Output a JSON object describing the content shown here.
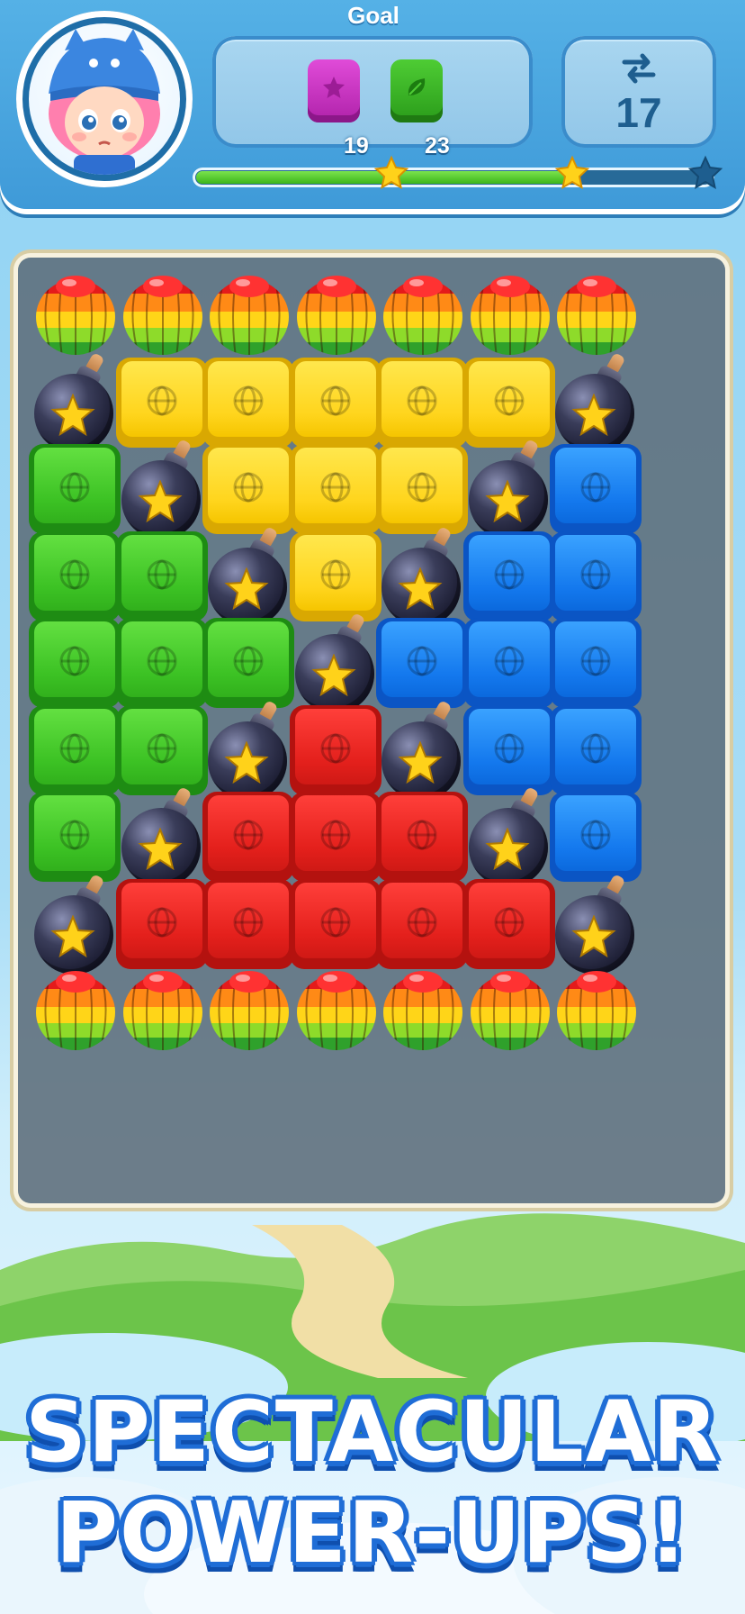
{
  "header": {
    "goal_title": "Goal",
    "goals": [
      {
        "icon": "purple-star-block-icon",
        "count": "19",
        "color": "#c62dc0"
      },
      {
        "icon": "green-leaf-block-icon",
        "count": "23",
        "color": "#37b022"
      }
    ],
    "moves": {
      "icon": "swap-arrows-icon",
      "count": "17"
    },
    "progress": {
      "fill_fraction": 0.73,
      "stars": [
        {
          "threshold": 0.38,
          "lit": true
        },
        {
          "threshold": 0.73,
          "lit": true
        },
        {
          "threshold": 1.0,
          "lit": false
        }
      ]
    }
  },
  "board": {
    "columns": 7,
    "rows": 9,
    "legend": {
      "P": "balloon-pinata",
      "B": "bomb-power-up",
      "y": "yellow-cube",
      "g": "green-cube",
      "b": "blue-cube",
      "r": "red-cube"
    },
    "grid": [
      [
        "P",
        "P",
        "P",
        "P",
        "P",
        "P",
        "P"
      ],
      [
        "B",
        "y",
        "y",
        "y",
        "y",
        "y",
        "B"
      ],
      [
        "g",
        "B",
        "y",
        "y",
        "y",
        "B",
        "b"
      ],
      [
        "g",
        "g",
        "B",
        "y",
        "B",
        "b",
        "b"
      ],
      [
        "g",
        "g",
        "g",
        "B",
        "b",
        "b",
        "b"
      ],
      [
        "g",
        "g",
        "B",
        "r",
        "B",
        "b",
        "b"
      ],
      [
        "g",
        "B",
        "r",
        "r",
        "r",
        "B",
        "b"
      ],
      [
        "B",
        "r",
        "r",
        "r",
        "r",
        "r",
        "B"
      ],
      [
        "P",
        "P",
        "P",
        "P",
        "P",
        "P",
        "P"
      ]
    ]
  },
  "banner": {
    "line1": "SPECTACULAR",
    "line2": "POWER-UPS!"
  },
  "colors": {
    "header_blue": "#4aa6e0",
    "progress_green": "#3cb51a",
    "banner_outline": "#1f6dd6"
  }
}
